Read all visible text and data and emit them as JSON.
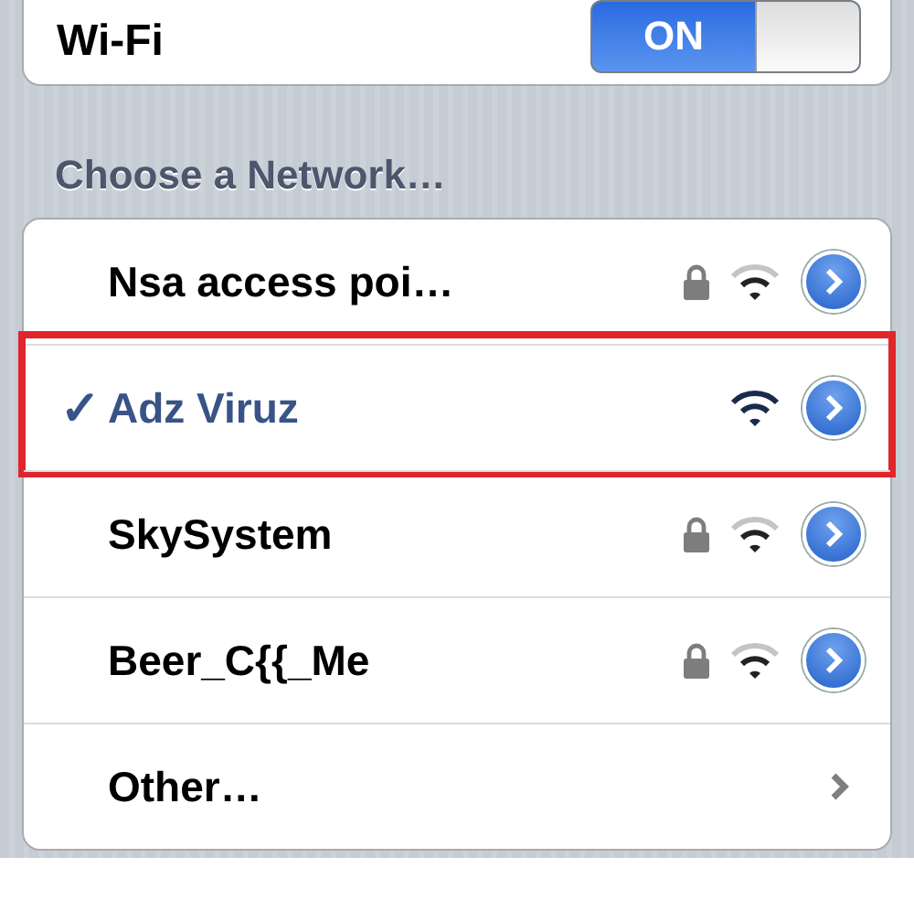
{
  "wifi_row": {
    "label": "Wi-Fi",
    "toggle": {
      "on": true,
      "label": "ON"
    }
  },
  "section_title": "Choose a Network…",
  "check_glyph": "✓",
  "networks": [
    {
      "kind": "network",
      "name": "Nsa access poi…",
      "selected": false,
      "locked": true,
      "highlighted": false
    },
    {
      "kind": "network",
      "name": "Adz Viruz",
      "selected": true,
      "locked": false,
      "highlighted": true
    },
    {
      "kind": "network",
      "name": "SkySystem",
      "selected": false,
      "locked": true,
      "highlighted": false
    },
    {
      "kind": "network",
      "name": "Beer_C{{_Me",
      "selected": false,
      "locked": true,
      "highlighted": false
    },
    {
      "kind": "other",
      "name": "Other…",
      "selected": false,
      "locked": false,
      "highlighted": false
    }
  ]
}
